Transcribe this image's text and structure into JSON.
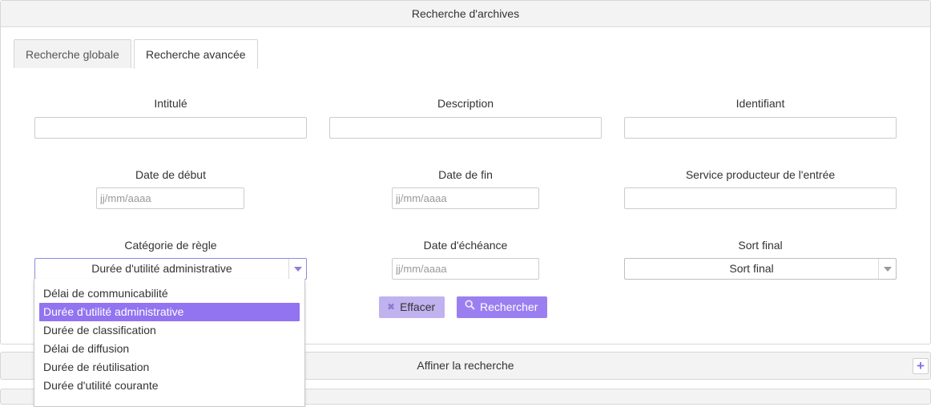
{
  "header": {
    "title": "Recherche d'archives"
  },
  "tabs": [
    {
      "label": "Recherche globale",
      "active": false
    },
    {
      "label": "Recherche avancée",
      "active": true
    }
  ],
  "fields": {
    "intitule": {
      "label": "Intitulé",
      "value": "",
      "placeholder": ""
    },
    "description": {
      "label": "Description",
      "value": "",
      "placeholder": ""
    },
    "identifiant": {
      "label": "Identifiant",
      "value": "",
      "placeholder": ""
    },
    "date_debut": {
      "label": "Date de début",
      "value": "",
      "placeholder": "jj/mm/aaaa"
    },
    "date_fin": {
      "label": "Date de fin",
      "value": "",
      "placeholder": "jj/mm/aaaa"
    },
    "service": {
      "label": "Service producteur de l'entrée",
      "value": "",
      "placeholder": ""
    },
    "categorie": {
      "label": "Catégorie de règle",
      "selected": "Durée d'utilité administrative"
    },
    "date_echeance": {
      "label": "Date d'échéance",
      "value": "",
      "placeholder": "jj/mm/aaaa"
    },
    "sort_final": {
      "label": "Sort final",
      "selected": "Sort final"
    }
  },
  "dropdown": {
    "options": [
      "Délai de communicabilité",
      "Durée d'utilité administrative",
      "Durée de classification",
      "Délai de diffusion",
      "Durée de réutilisation",
      "Durée d'utilité courante"
    ],
    "selected_index": 1
  },
  "buttons": {
    "clear": {
      "label": "Effacer",
      "icon": "close-icon"
    },
    "search": {
      "label": "Rechercher",
      "icon": "search-icon"
    }
  },
  "refine": {
    "title": "Affiner la recherche",
    "icon": "plus-icon",
    "icon_glyph": "+"
  },
  "colors": {
    "accent": "#9b7ff0",
    "accent_light": "#c0b2ef",
    "selected_option": "#9273f0"
  }
}
